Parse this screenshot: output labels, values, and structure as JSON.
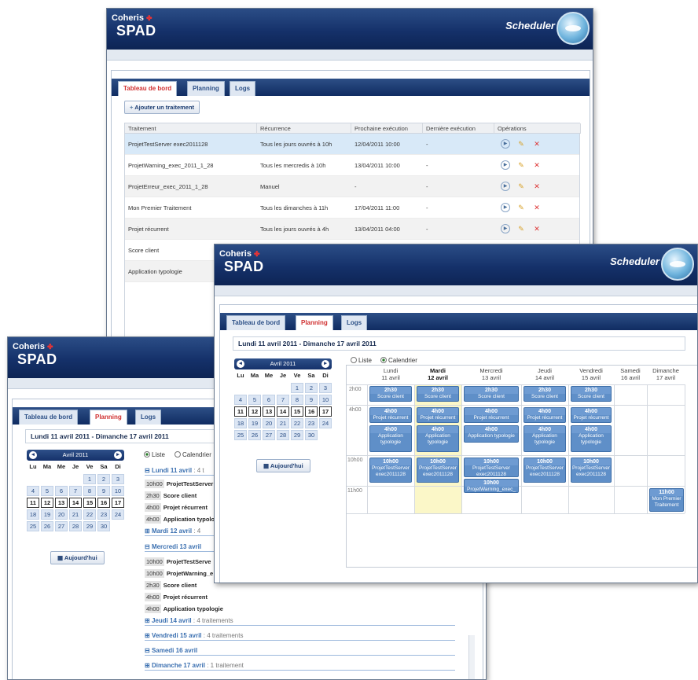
{
  "brand": {
    "top": "Coheris",
    "bottom": "SPAD",
    "app_title": "Scheduler"
  },
  "tabs": [
    {
      "label": "Tableau de bord"
    },
    {
      "label": "Planning"
    },
    {
      "label": "Logs"
    }
  ],
  "dashboard": {
    "add_button": "Ajouter un traitement",
    "columns": [
      "Traitement",
      "Récurrence",
      "Prochaine exécution",
      "Dernière exécution",
      "Opérations"
    ],
    "rows": [
      {
        "name": "ProjetTestServer exec2011128",
        "recurrence": "Tous les jours ouvrés à 10h",
        "next": "12/04/2011 10:00",
        "last": "-"
      },
      {
        "name": "ProjetWarning_exec_2011_1_28",
        "recurrence": "Tous les mercredis à 10h",
        "next": "13/04/2011 10:00",
        "last": "-"
      },
      {
        "name": "ProjetErreur_exec_2011_1_28",
        "recurrence": "Manuel",
        "next": "-",
        "last": "-"
      },
      {
        "name": "Mon Premier Traitement",
        "recurrence": "Tous les dimanches à 11h",
        "next": "17/04/2011 11:00",
        "last": "-"
      },
      {
        "name": "Projet récurrent",
        "recurrence": "Tous les jours ouvrés à 4h",
        "next": "13/04/2011 04:00",
        "last": "-"
      },
      {
        "name": "Score client",
        "recurrence": "",
        "next": "",
        "last": ""
      },
      {
        "name": "Application typologie",
        "recurrence": "",
        "next": "",
        "last": ""
      }
    ]
  },
  "planning": {
    "date_range": "Lundi 11 avril 2011 - Dimanche 17 avril 2011",
    "month": "Avril 2011",
    "day_names": [
      "Lu",
      "Ma",
      "Me",
      "Je",
      "Ve",
      "Sa",
      "Di"
    ],
    "weeks": [
      [
        "",
        "",
        "",
        "",
        "1",
        "2",
        "3"
      ],
      [
        "4",
        "5",
        "6",
        "7",
        "8",
        "9",
        "10"
      ],
      [
        "11",
        "12",
        "13",
        "14",
        "15",
        "16",
        "17"
      ],
      [
        "18",
        "19",
        "20",
        "21",
        "22",
        "23",
        "24"
      ],
      [
        "25",
        "26",
        "27",
        "28",
        "29",
        "30",
        ""
      ]
    ],
    "current_week_index": 2,
    "today_button": "Aujourd'hui",
    "view_list": "Liste",
    "view_calendar": "Calendrier"
  },
  "calendar_view": {
    "days": [
      {
        "name": "Lundi",
        "date": "11 avril"
      },
      {
        "name": "Mardi",
        "date": "12 avril"
      },
      {
        "name": "Mercredi",
        "date": "13 avril"
      },
      {
        "name": "Jeudi",
        "date": "14 avril"
      },
      {
        "name": "Vendredi",
        "date": "15 avril"
      },
      {
        "name": "Samedi",
        "date": "16 avril"
      },
      {
        "name": "Dimanche",
        "date": "17 avril"
      }
    ],
    "times": [
      "2h00",
      "4h00",
      "10h00",
      "11h00"
    ],
    "events": {
      "score": {
        "time": "2h30",
        "name": "Score client"
      },
      "recurrent": {
        "time": "4h00",
        "name": "Projet récurrent"
      },
      "typologie": {
        "time": "4h00",
        "name": "Application typologie"
      },
      "testserver": {
        "time": "10h00",
        "name": "ProjetTestServer exec2011128"
      },
      "warning": {
        "time": "10h00",
        "name": "ProjetWarning_exec_"
      },
      "premier": {
        "time": "11h00",
        "name": "Mon Premier Traitement"
      }
    }
  },
  "list_view": {
    "groups": [
      {
        "label": "Lundi 11 avril",
        "count": ": 4 t"
      },
      {
        "label": "Mardi 12 avril",
        "count": ": 4"
      },
      {
        "label": "Mercredi 13 avril",
        "count": ""
      },
      {
        "label": "Jeudi 14 avril",
        "count": ": 4 traitements"
      },
      {
        "label": "Vendredi 15 avril",
        "count": ": 4 traitements"
      },
      {
        "label": "Samedi 16 avril",
        "count": ""
      },
      {
        "label": "Dimanche 17 avril",
        "count": ": 1 traitement"
      }
    ],
    "monday_items": [
      {
        "time": "10h00",
        "name": "ProjetTestServer"
      },
      {
        "time": "2h30",
        "name": "Score client"
      },
      {
        "time": "4h00",
        "name": "Projet récurrent"
      },
      {
        "time": "4h00",
        "name": "Application typolo"
      }
    ],
    "wednesday_items": [
      {
        "time": "10h00",
        "name": "ProjetTestServe"
      },
      {
        "time": "10h00",
        "name": "ProjetWarning_e"
      },
      {
        "time": "2h30",
        "name": "Score client"
      },
      {
        "time": "4h00",
        "name": "Projet récurrent"
      },
      {
        "time": "4h00",
        "name": "Application typologie"
      }
    ]
  },
  "colors": {
    "header": "#15316a",
    "active_tab": "#d03030",
    "event": "#5f8fc8",
    "today": "#fbf7c8"
  }
}
